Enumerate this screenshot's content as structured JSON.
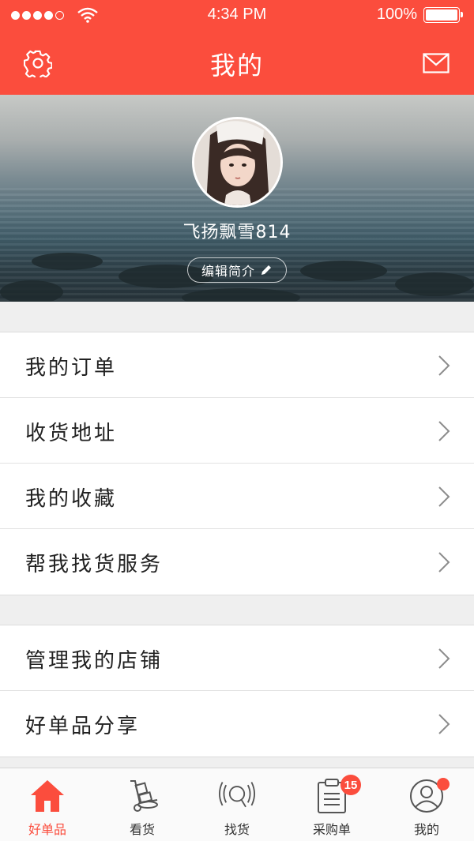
{
  "status": {
    "signal_dots": 5,
    "time": "4:34 PM",
    "battery": "100%",
    "battery_level": 1.0
  },
  "header": {
    "title": "我的",
    "left_icon": "gear-icon",
    "right_icon": "mail-icon"
  },
  "profile": {
    "name": "飞扬飘雪814",
    "edit_label": "编辑简介"
  },
  "menu": {
    "group1": [
      {
        "label": "我的订单"
      },
      {
        "label": "收货地址"
      },
      {
        "label": "我的收藏"
      },
      {
        "label": "帮我找货服务"
      }
    ],
    "group2": [
      {
        "label": "管理我的店铺"
      },
      {
        "label": "好单品分享"
      }
    ]
  },
  "tabbar": {
    "tabs": [
      {
        "label": "好单品",
        "icon": "home-icon",
        "active": true
      },
      {
        "label": "看货",
        "icon": "hand-truck-icon"
      },
      {
        "label": "找货",
        "icon": "radar-search-icon"
      },
      {
        "label": "采购单",
        "icon": "clipboard-icon",
        "badge": "15"
      },
      {
        "label": "我的",
        "icon": "user-icon",
        "dot": true
      }
    ]
  },
  "colors": {
    "accent": "#fb4d3d",
    "background": "#efefef"
  }
}
